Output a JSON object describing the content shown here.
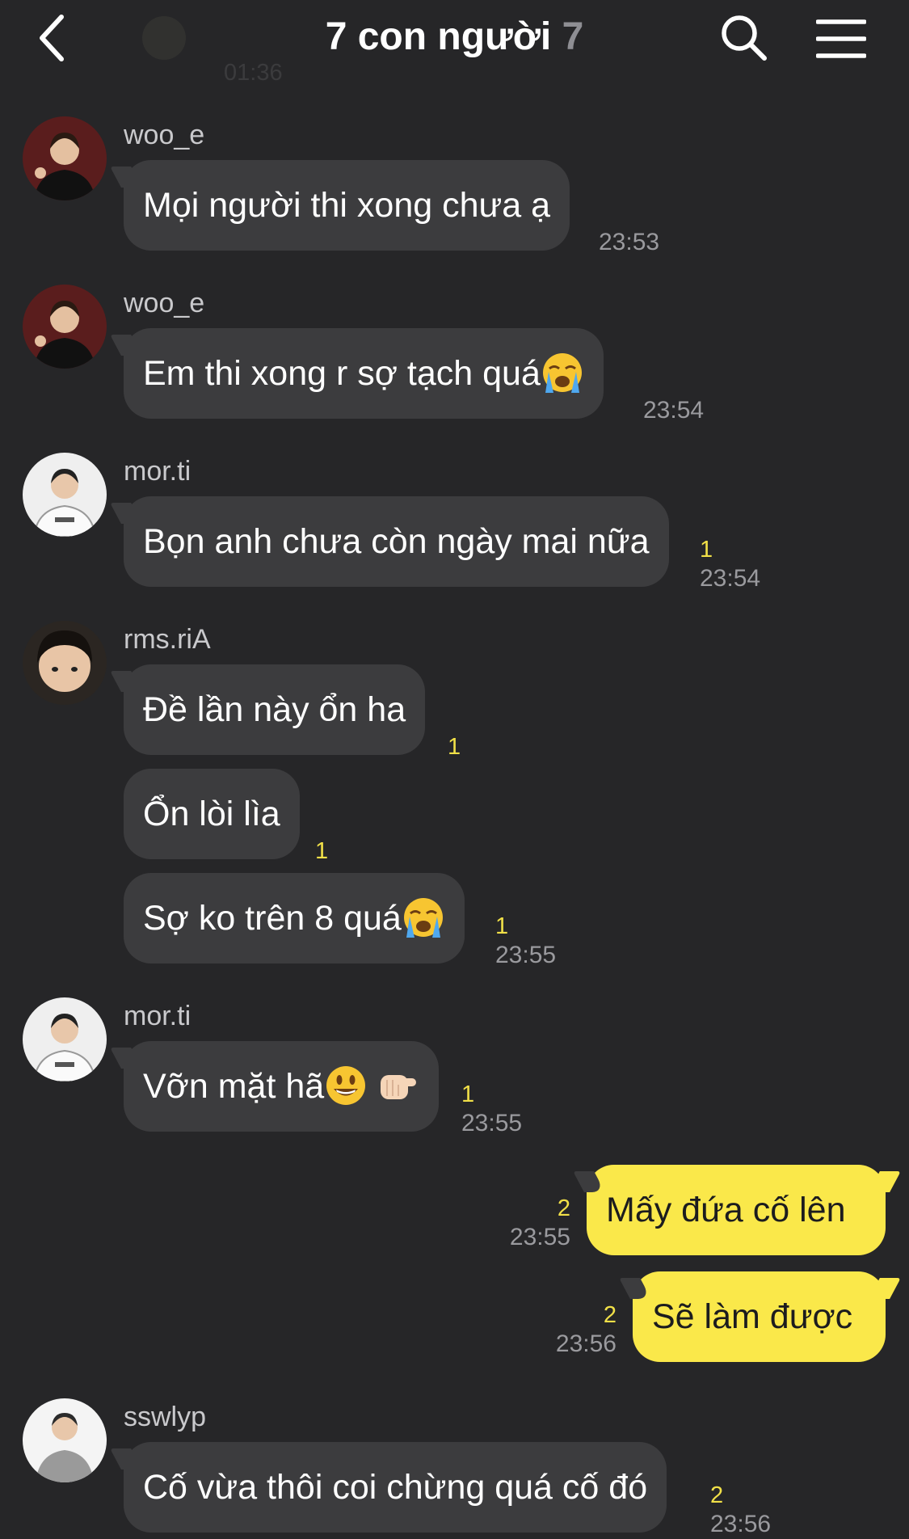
{
  "header": {
    "title": "7 con người",
    "member_count": "7",
    "faded_time": "01:36",
    "icons": {
      "back": "chevron-left-icon",
      "search": "search-icon",
      "menu": "hamburger-menu-icon"
    }
  },
  "colors": {
    "background": "#262628",
    "bubble_other": "#3c3c3e",
    "bubble_mine": "#fae84a",
    "unread": "#f1e048",
    "time": "#9a9a9e"
  },
  "messages": [
    {
      "sender": "woo_e",
      "text": "Mọi người thi xong chưa ạ",
      "unread": "",
      "time": "23:53"
    },
    {
      "sender": "woo_e",
      "text": "Em thi xong r sợ tạch quá",
      "emoji": "loudly-crying-face",
      "unread": "",
      "time": "23:54"
    },
    {
      "sender": "mor.ti",
      "text": "Bọn anh chưa còn ngày mai nữa",
      "unread": "1",
      "time": "23:54"
    },
    {
      "sender": "rms.riA",
      "text": "Đề lần này ổn ha",
      "unread": "1",
      "time": ""
    },
    {
      "sender": "rms.riA",
      "text": "Ổn lòi lìa",
      "unread": "1",
      "time": ""
    },
    {
      "sender": "rms.riA",
      "text": "Sợ ko trên 8 quá",
      "emoji": "loudly-crying-face",
      "unread": "1",
      "time": "23:55"
    },
    {
      "sender": "mor.ti",
      "text": "Vỡn mặt hã",
      "emoji": "grinning-face, pointing-hand",
      "unread": "1",
      "time": "23:55"
    },
    {
      "sender": "me",
      "text": "Mấy đứa cố lên",
      "unread": "2",
      "time": "23:55"
    },
    {
      "sender": "me",
      "text": "Sẽ làm được",
      "unread": "2",
      "time": "23:56"
    },
    {
      "sender": "sswlyp",
      "text": "Cố vừa thôi coi chừng quá cố đó",
      "unread": "2",
      "time": "23:56"
    }
  ]
}
